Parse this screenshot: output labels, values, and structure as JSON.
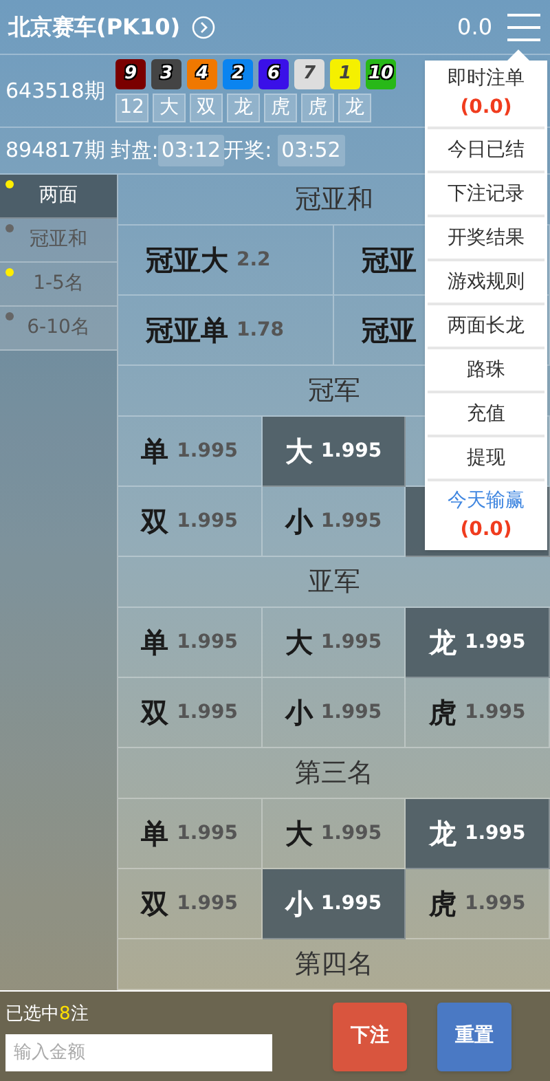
{
  "header": {
    "title": "北京赛车(PK10)",
    "balance": "0.0"
  },
  "last_draw": {
    "issue": "643518期",
    "balls": [
      {
        "number": "9",
        "color": "#7a0000"
      },
      {
        "number": "3",
        "color": "#444444"
      },
      {
        "number": "4",
        "color": "#f07800"
      },
      {
        "number": "2",
        "color": "#0a84f0"
      },
      {
        "number": "6",
        "color": "#3a10e8"
      },
      {
        "number": "7",
        "color": "#dddddd"
      },
      {
        "number": "1",
        "color": "#f5f000"
      },
      {
        "number": "10",
        "color": "#28b818"
      }
    ],
    "results": [
      "12",
      "大",
      "双",
      "龙",
      "虎",
      "虎",
      "龙"
    ]
  },
  "current_draw": {
    "issue": "894817期",
    "close_label": "封盘:",
    "close_time": "03:12",
    "open_label": "开奖:",
    "open_time": "03:52"
  },
  "sidebar": [
    {
      "label": "两面",
      "selected": true,
      "has_bets": true
    },
    {
      "label": "冠亚和",
      "selected": false,
      "has_bets": false
    },
    {
      "label": "1-5名",
      "selected": false,
      "has_bets": true
    },
    {
      "label": "6-10名",
      "selected": false,
      "has_bets": false
    }
  ],
  "sections": [
    {
      "title": "冠亚和",
      "kind": "sum",
      "cells": [
        {
          "label": "冠亚大",
          "odds": "2.2",
          "selected": false
        },
        {
          "label": "冠亚",
          "selected": false
        },
        {
          "label": "冠亚单",
          "odds": "1.78",
          "selected": false
        },
        {
          "label": "冠亚",
          "selected": false
        }
      ]
    },
    {
      "title": "冠军",
      "kind": "position",
      "cells": [
        {
          "label": "单",
          "odds": "1.995",
          "selected": false
        },
        {
          "label": "大",
          "odds": "1.995",
          "selected": true
        },
        {
          "selected": false
        },
        {
          "label": "双",
          "odds": "1.995",
          "selected": false
        },
        {
          "label": "小",
          "odds": "1.995",
          "selected": false
        },
        {
          "selected": true
        }
      ]
    },
    {
      "title": "亚军",
      "kind": "position",
      "cells": [
        {
          "label": "单",
          "odds": "1.995",
          "selected": false
        },
        {
          "label": "大",
          "odds": "1.995",
          "selected": false
        },
        {
          "label": "龙",
          "odds": "1.995",
          "selected": true
        },
        {
          "label": "双",
          "odds": "1.995",
          "selected": false
        },
        {
          "label": "小",
          "odds": "1.995",
          "selected": false
        },
        {
          "label": "虎",
          "odds": "1.995",
          "selected": false
        }
      ]
    },
    {
      "title": "第三名",
      "kind": "position",
      "cells": [
        {
          "label": "单",
          "odds": "1.995",
          "selected": false
        },
        {
          "label": "大",
          "odds": "1.995",
          "selected": false
        },
        {
          "label": "龙",
          "odds": "1.995",
          "selected": true
        },
        {
          "label": "双",
          "odds": "1.995",
          "selected": false
        },
        {
          "label": "小",
          "odds": "1.995",
          "selected": true
        },
        {
          "label": "虎",
          "odds": "1.995",
          "selected": false
        }
      ]
    },
    {
      "title": "第四名"
    }
  ],
  "menu": [
    {
      "label": "即时注单",
      "amount": "(0.0)",
      "accent": false
    },
    {
      "label": "今日已结",
      "accent": false
    },
    {
      "label": "下注记录",
      "accent": false
    },
    {
      "label": "开奖结果",
      "accent": false
    },
    {
      "label": "游戏规则",
      "accent": false
    },
    {
      "label": "两面长龙",
      "accent": false
    },
    {
      "label": "路珠",
      "accent": false
    },
    {
      "label": "充值",
      "accent": false
    },
    {
      "label": "提现",
      "accent": false
    },
    {
      "label": "今天输赢",
      "amount": "(0.0)",
      "accent": true
    }
  ],
  "bet_bar": {
    "selected_prefix": "已选中",
    "selected_count": "8",
    "selected_suffix": "注",
    "amount_placeholder": "输入金额",
    "buttons": [
      {
        "label": "下注",
        "kind": "submit"
      },
      {
        "label": "重置",
        "kind": "reset"
      }
    ]
  }
}
